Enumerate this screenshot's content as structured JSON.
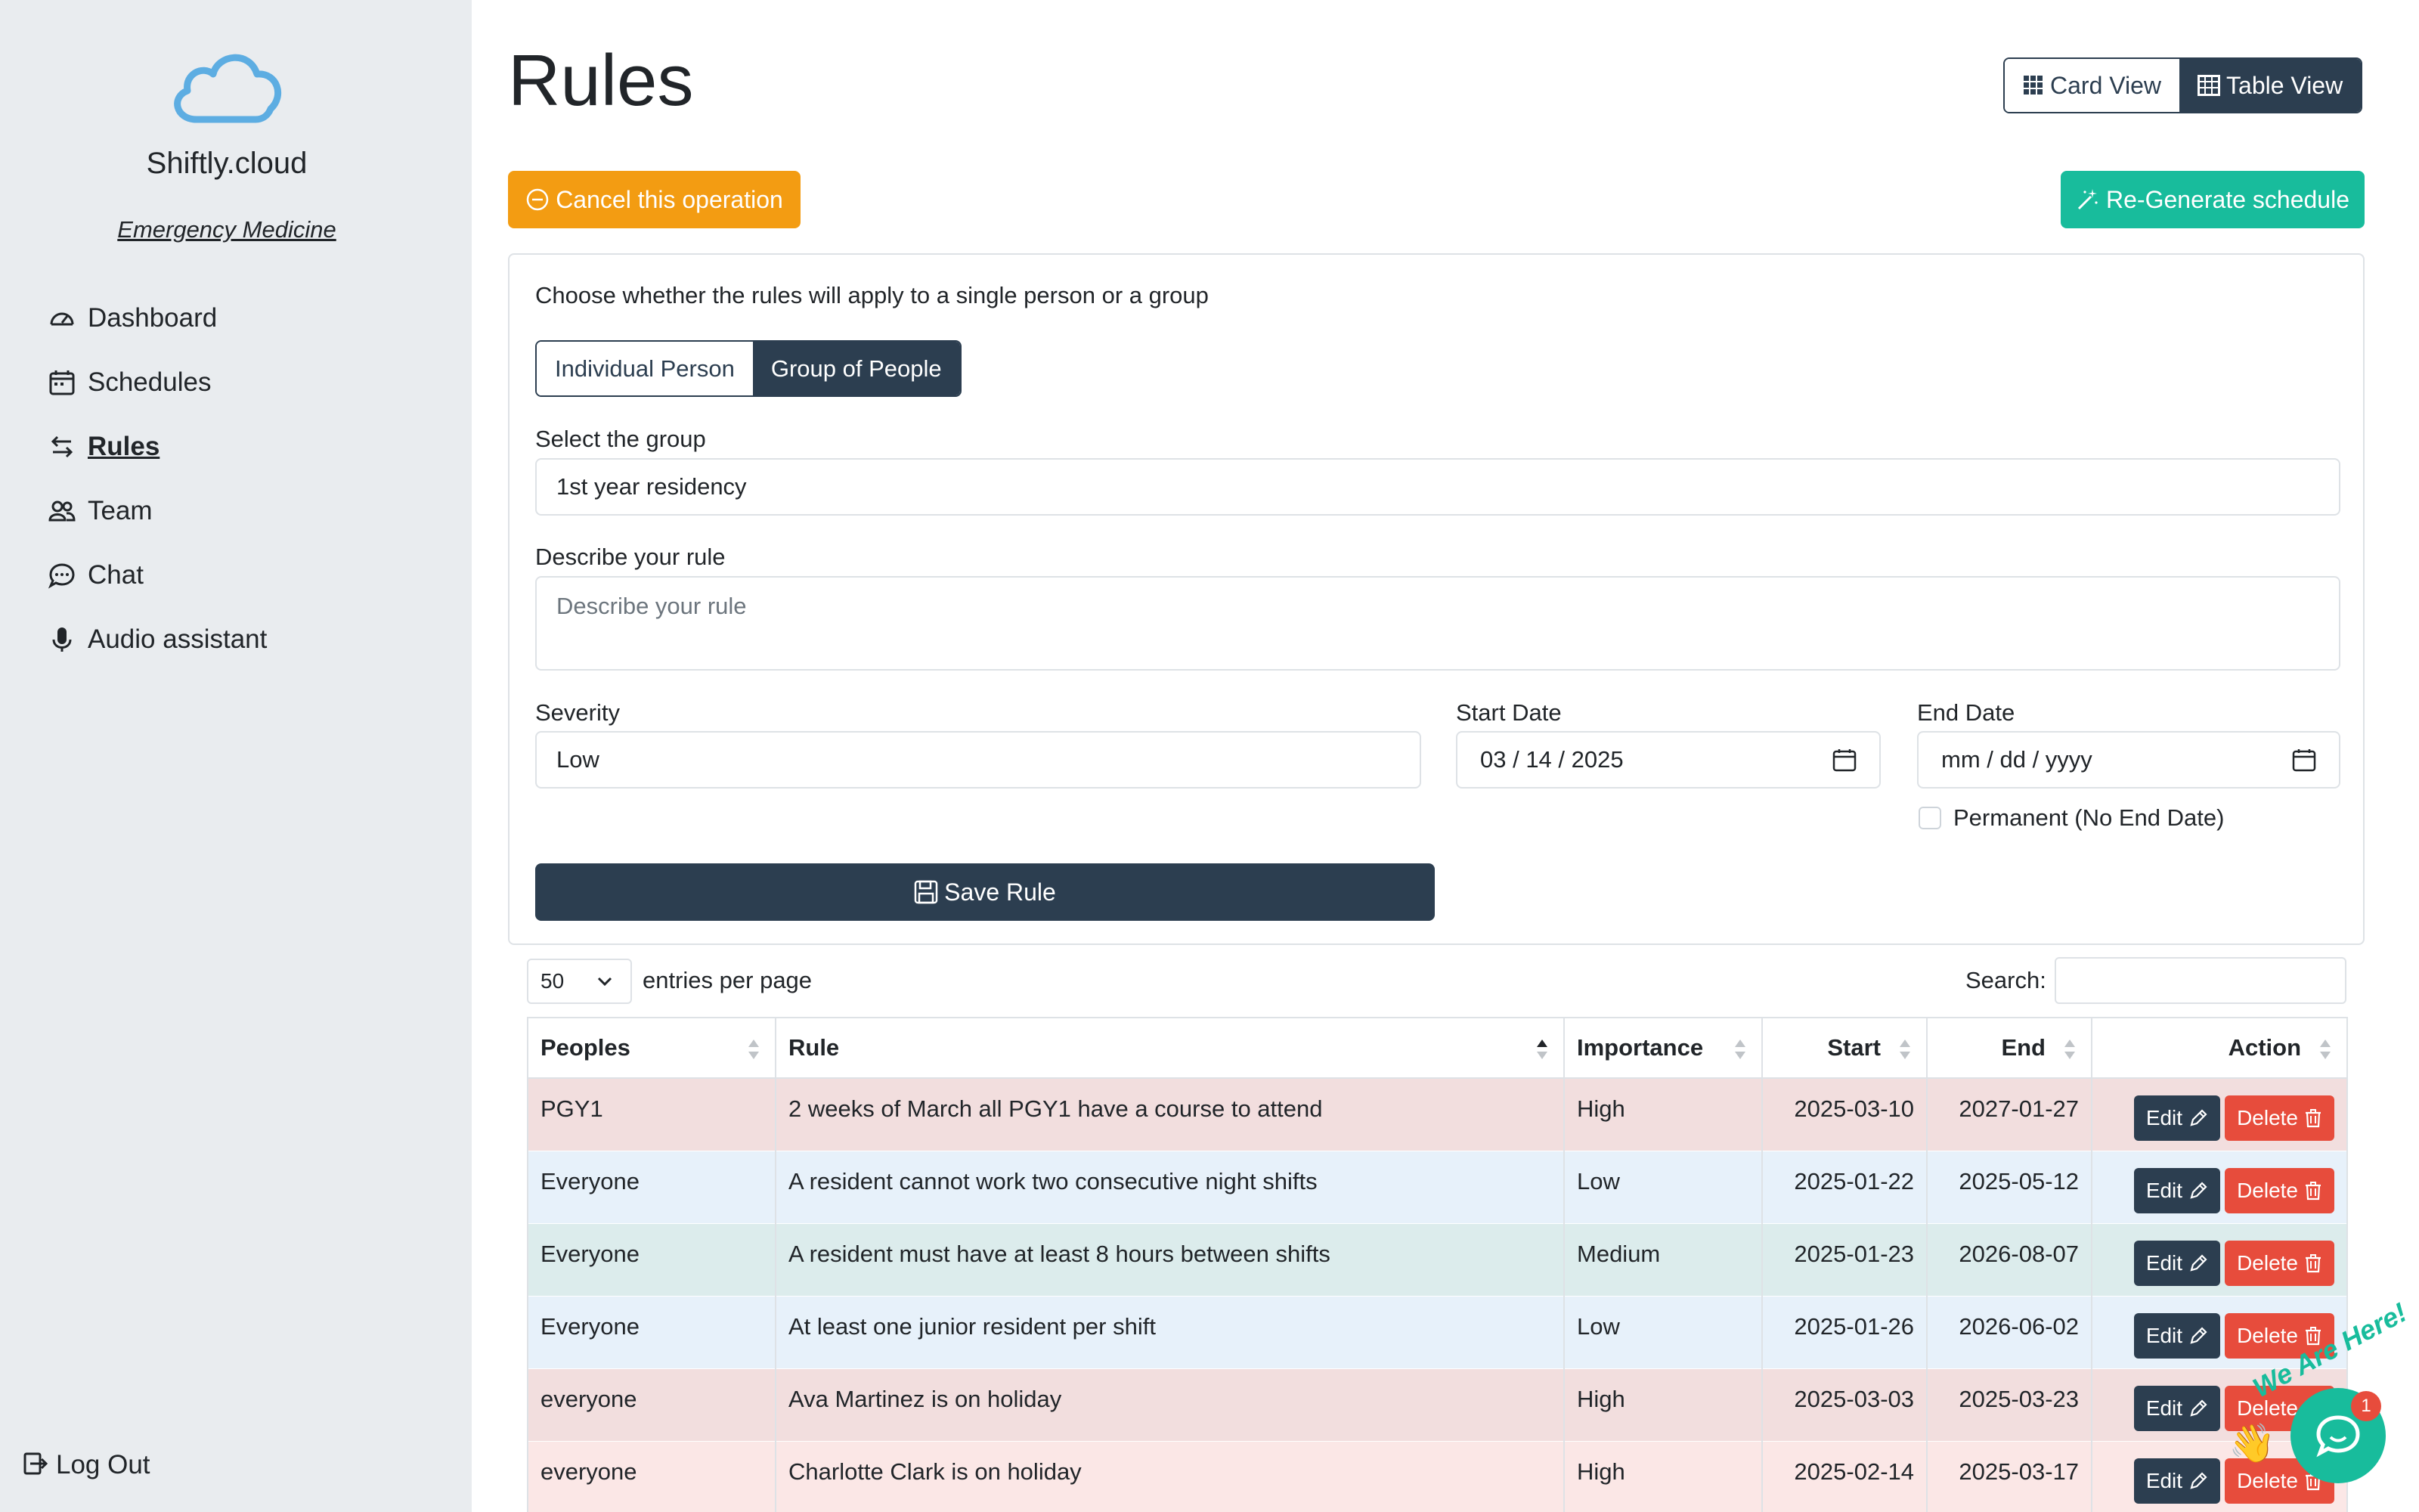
{
  "brand": {
    "name": "Shiftly.cloud",
    "department": "Emergency Medicine"
  },
  "nav": [
    {
      "label": "Dashboard",
      "icon": "gauge-icon"
    },
    {
      "label": "Schedules",
      "icon": "calendar-icon"
    },
    {
      "label": "Rules",
      "icon": "arrows-icon",
      "active": true
    },
    {
      "label": "Team",
      "icon": "people-icon"
    },
    {
      "label": "Chat",
      "icon": "chat-icon"
    },
    {
      "label": "Audio assistant",
      "icon": "mic-icon"
    }
  ],
  "logout": "Log Out",
  "page": {
    "title": "Rules"
  },
  "view_toggle": {
    "card": "Card View",
    "table": "Table View",
    "selected": "Table View"
  },
  "actions": {
    "cancel": "Cancel this operation",
    "regenerate": "Re-Generate schedule"
  },
  "form": {
    "scope_prompt": "Choose whether the rules will apply to a single person or a group",
    "scope_options": [
      "Individual Person",
      "Group of People"
    ],
    "scope_selected": "Group of People",
    "group_label": "Select the group",
    "group_value": "1st year residency",
    "rule_label": "Describe your rule",
    "rule_placeholder": "Describe your rule",
    "severity_label": "Severity",
    "severity_value": "Low",
    "start_label": "Start Date",
    "start_value": "03 / 14 / 2025",
    "end_label": "End Date",
    "end_placeholder": "mm / dd / yyyy",
    "permanent_label": "Permanent (No End Date)",
    "save": "Save Rule"
  },
  "table_controls": {
    "page_size": "50",
    "page_size_text": "entries per page",
    "search_label": "Search:"
  },
  "table": {
    "columns": [
      "Peoples",
      "Rule",
      "Importance",
      "Start",
      "End",
      "Action"
    ],
    "rows": [
      {
        "peoples": "PGY1",
        "rule": "2 weeks of March all PGY1 have a course to attend",
        "importance": "High",
        "start": "2025-03-10",
        "end": "2027-01-27",
        "color": "#f2dede"
      },
      {
        "peoples": "Everyone",
        "rule": "A resident cannot work two consecutive night shifts",
        "importance": "Low",
        "start": "2025-01-22",
        "end": "2025-05-12",
        "color": "#e7f1fa"
      },
      {
        "peoples": "Everyone",
        "rule": "A resident must have at least 8 hours between shifts",
        "importance": "Medium",
        "start": "2025-01-23",
        "end": "2026-08-07",
        "color": "#dcecec"
      },
      {
        "peoples": "Everyone",
        "rule": "At least one junior resident per shift",
        "importance": "Low",
        "start": "2025-01-26",
        "end": "2026-06-02",
        "color": "#e7f1fa"
      },
      {
        "peoples": "everyone",
        "rule": "Ava Martinez is on holiday",
        "importance": "High",
        "start": "2025-03-03",
        "end": "2025-03-23",
        "color": "#f2dede"
      },
      {
        "peoples": "everyone",
        "rule": "Charlotte Clark is on holiday",
        "importance": "High",
        "start": "2025-02-14",
        "end": "2025-03-17",
        "color": "#fbe7e6"
      }
    ],
    "edit_label": "Edit",
    "delete_label": "Delete"
  },
  "chat_widget": {
    "tagline": "We Are Here!",
    "badge": "1"
  },
  "colors": {
    "primary": "#2c3e50",
    "warning": "#f39c12",
    "success": "#18bc9c",
    "danger": "#e74c3c",
    "sidebar": "#e9ecef"
  }
}
